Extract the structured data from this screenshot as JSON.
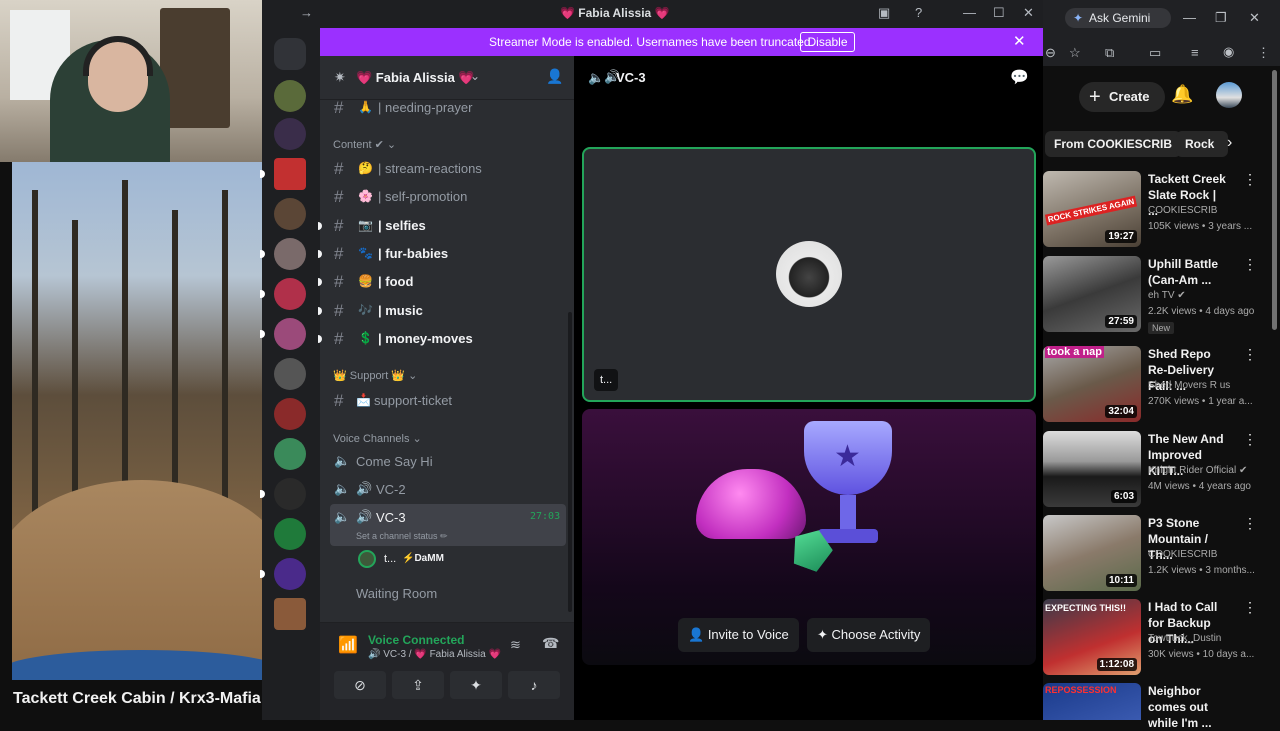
{
  "left_video": {
    "title": "Tackett Creek Cabin / Krx3-Mafia"
  },
  "discord": {
    "window_title": "💗 Fabia Alissia 💗",
    "streamer_banner": {
      "message": "Streamer Mode is enabled. Usernames have been truncated.",
      "disable_label": "Disable"
    },
    "server_name": "💗 Fabia Alissia 💗",
    "channels_top": [
      {
        "emoji": "🙏",
        "label": "| needing-prayer",
        "unread": false
      }
    ],
    "category_content": "Content ✔",
    "content_channels": [
      {
        "emoji": "🤔",
        "label": "| stream-reactions",
        "unread": false
      },
      {
        "emoji": "🌸",
        "label": "| self-promotion",
        "unread": false
      },
      {
        "emoji": "📷",
        "label": "| selfies",
        "unread": true
      },
      {
        "emoji": "🐾",
        "label": "| fur-babies",
        "unread": true
      },
      {
        "emoji": "🍔",
        "label": "| food",
        "unread": true
      },
      {
        "emoji": "🎶",
        "label": "| music",
        "unread": true
      },
      {
        "emoji": "💲",
        "label": "| money-moves",
        "unread": true
      }
    ],
    "category_support": "👑 Support 👑",
    "support_channels": [
      {
        "emoji": "📩",
        "label": "support-ticket"
      }
    ],
    "category_voice": "Voice Channels",
    "voice_channels": [
      {
        "label": "Come Say Hi"
      },
      {
        "label": "VC-2"
      },
      {
        "label": "VC-3",
        "time": "27:03",
        "status": "Set a channel status ✏",
        "user": "t...",
        "user_tag": "⚡DaMM"
      },
      {
        "label": "Waiting Room"
      }
    ],
    "voice_panel": {
      "status": "Voice Connected",
      "sub": "🔊 VC-3 / 💗 Fabia Alissia 💗"
    },
    "main_header": "VC-3",
    "tile_user": "t...",
    "buttons": {
      "invite": "Invite to Voice",
      "activity": "Choose Activity"
    }
  },
  "browser": {
    "ask_gemini": "Ask Gemini",
    "create_label": "Create",
    "chips": [
      "From COOKIESCRIB",
      "Rock"
    ],
    "videos": [
      {
        "title": "Tackett Creek Slate Rock | ...",
        "channel": "COOKIESCRIB",
        "meta": "105K views • 3 years ...",
        "duration": "19:27",
        "overlay": "ROCK STRIKES AGAIN"
      },
      {
        "title": "Uphill Battle (Can-Am ...",
        "channel": "eh TV ✔",
        "meta": "2.2K views • 4 days ago",
        "duration": "27:59",
        "badge": "New"
      },
      {
        "title": "Shed Repo Re-Delivery Fail: ...",
        "channel": "Shed Movers R us",
        "meta": "270K views • 1 year a...",
        "duration": "32:04",
        "overlay": "took a nap"
      },
      {
        "title": "The New And Improved KITT...",
        "channel": "Knight Rider Official ✔",
        "meta": "4M views • 4 years ago",
        "duration": "6:03"
      },
      {
        "title": "P3 Stone Mountain / Th...",
        "channel": "COOKIESCRIB",
        "meta": "1.2K views • 3 months...",
        "duration": "10:11"
      },
      {
        "title": "I Had to Call for Backup on Thi...",
        "channel": "Towtruck_Dustin",
        "meta": "30K views • 10 days a...",
        "duration": "1:12:08",
        "overlay": "EXPECTING THIS!!"
      },
      {
        "title": "Neighbor comes out while I'm ...",
        "overlay": "REPOSSESSION"
      }
    ]
  }
}
